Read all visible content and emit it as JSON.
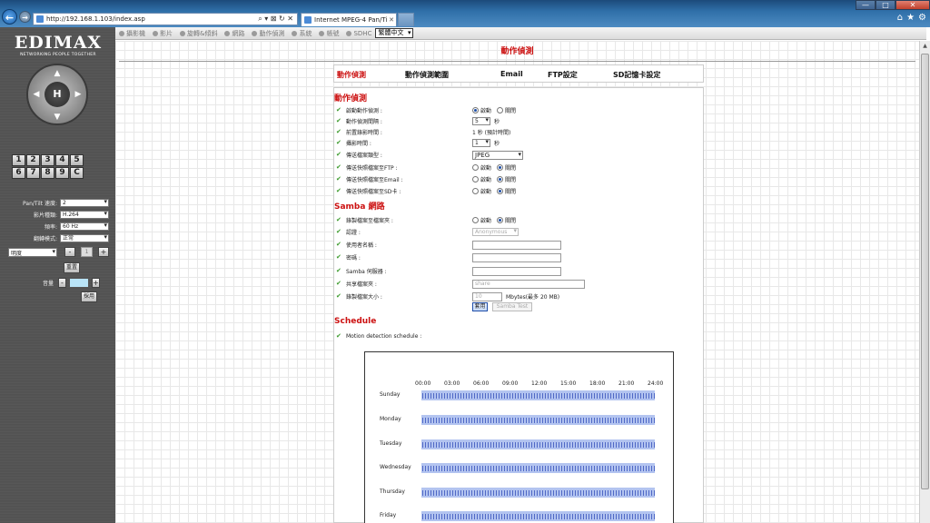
{
  "browser": {
    "url": "http://192.168.1.103/index.asp",
    "tab_title": "Internet MPEG-4 Pan/Tilt ...",
    "address_controls": "⌕ ▾ ⊠ ↻ ✕",
    "tab_close": "✕",
    "window_controls": [
      "—",
      "□",
      "✕"
    ],
    "toolbar_icons": [
      "⌂",
      "★",
      "⚙"
    ]
  },
  "sidebar": {
    "brand": "EDIMAX",
    "tagline": "NETWORKING PEOPLE TOGETHER",
    "ptz_home": "H",
    "ptz_arrows": {
      "up": "▲",
      "down": "▼",
      "left": "◀",
      "right": "▶"
    },
    "preset_keys": [
      "1",
      "2",
      "3",
      "4",
      "5",
      "6",
      "7",
      "8",
      "9",
      "C"
    ],
    "controls": [
      {
        "label": "Pan/Tilt 速度:",
        "value": "2"
      },
      {
        "label": "影片種類:",
        "value": "H.264"
      },
      {
        "label": "頻率:",
        "value": "60 Hz"
      },
      {
        "label": "翻轉模式:",
        "value": "正常"
      }
    ],
    "brightness": {
      "select": "明度",
      "minus": "-",
      "value": "1",
      "plus": "+"
    },
    "reset_label": "重置",
    "volume": {
      "label": "音量",
      "minus": "-",
      "plus": "+"
    },
    "apply_label": "採用"
  },
  "topmenu": {
    "items": [
      "攝影機",
      "影片",
      "旋轉&傾斜",
      "網路",
      "動作偵測",
      "系統",
      "帳號",
      "SDHC"
    ],
    "language": "繁體中文"
  },
  "main": {
    "page_title": "動作偵測",
    "tabs": [
      "動作偵測",
      "動作偵測範圍",
      "Email",
      "FTP設定",
      "SD記憶卡設定"
    ],
    "motion": {
      "section_title": "動作偵測",
      "enable_label": "啟動動作偵測 :",
      "interval_label": "動作偵測間隔 :",
      "interval_value": "5",
      "interval_unit": "秒",
      "pre_record_label": "前置錄影時間 :",
      "pre_record_value": "1 秒 (預計時間)",
      "post_record_label": "攝影時間 :",
      "post_record_value": "1",
      "post_record_unit": "秒",
      "file_type_label": "傳送檔案類型 :",
      "file_type_value": "JPEG",
      "ftp_label": "傳送快照檔案至FTP :",
      "email_label": "傳送快照檔案至Email :",
      "sd_label": "傳送快照檔案至SD卡 :",
      "on": "啟動",
      "off": "關閉"
    },
    "samba": {
      "section_title": "Samba 網路",
      "record_label": "錄製檔案至檔案夾 :",
      "auth_label": "認證 :",
      "auth_value": "Anonymous",
      "username_label": "使用者名稱 :",
      "password_label": "密碼 :",
      "server_label": "Samba 伺服器 :",
      "share_label": "共享檔案夾 :",
      "share_placeholder": "share",
      "size_label": "錄製檔案大小 :",
      "size_value": "10",
      "size_unit": "Mbytes(最多 20 MB)",
      "save_label": "套用",
      "test_label": "Samba Test"
    },
    "schedule": {
      "section_title": "Schedule",
      "label": "Motion detection schedule :",
      "hours": [
        "00:00",
        "03:00",
        "06:00",
        "09:00",
        "12:00",
        "15:00",
        "18:00",
        "21:00",
        "24:00"
      ],
      "days": [
        "Sunday",
        "Monday",
        "Tuesday",
        "Wednesday",
        "Thursday",
        "Friday"
      ]
    }
  },
  "scrollbar": {
    "up": "▲"
  },
  "colors": {
    "accent_red": "#cc1111",
    "check_green": "#3a9a2a",
    "schedule_bar": "#b3c4f0",
    "schedule_tick": "#4f68c6"
  }
}
